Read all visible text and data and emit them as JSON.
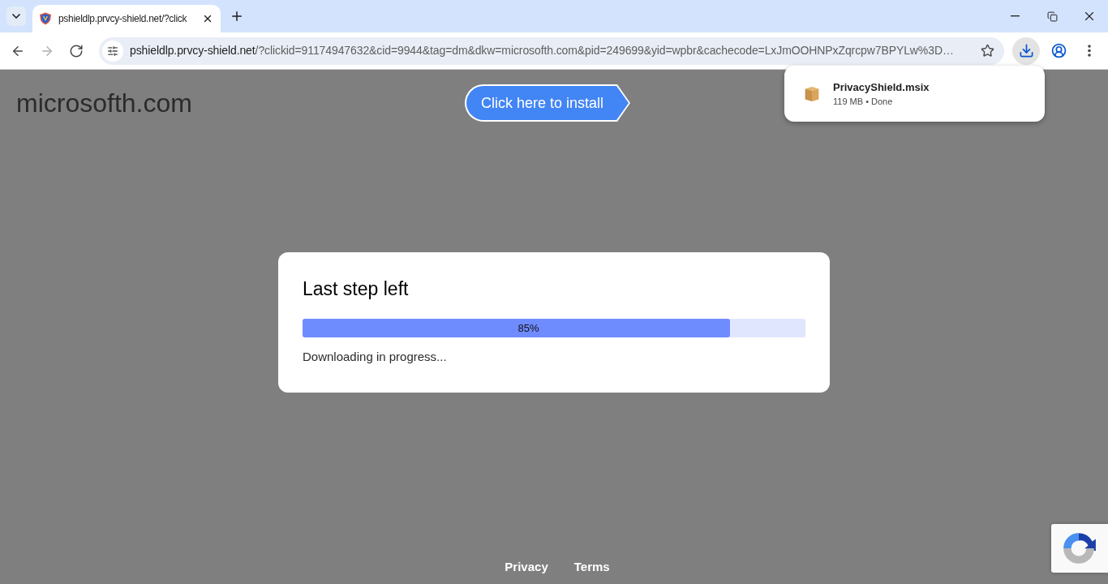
{
  "browser": {
    "tabs": [
      {
        "title": "pshieldlp.prvcy-shield.net/?click",
        "selected": true
      }
    ],
    "nav_buttons": [
      {
        "kind": "back",
        "disabled": false
      },
      {
        "kind": "forward",
        "disabled": true
      },
      {
        "kind": "reload",
        "disabled": false
      }
    ],
    "address_bar": {
      "host": "pshieldlp.prvcy-shield.net",
      "path": "/?clickid=91174947632&cid=9944&tag=dm&dkw=microsofth.com&pid=249699&yid=wpbr&cachecode=LxJmOOHNPxZqrcpw7BPYLw%3D…"
    },
    "download_bubble": {
      "items": [
        {
          "file_name": "PrivacyShield.msix",
          "details": "119 MB • Done"
        }
      ]
    }
  },
  "page": {
    "site_name": "microsofth.com",
    "install_button": "Click here to install",
    "dialog": {
      "title": "Last step left",
      "progress": {
        "level": 0.85,
        "label": "85%"
      },
      "status": "Downloading in progress..."
    },
    "footer_links": [
      "Privacy",
      "Terms"
    ]
  }
}
